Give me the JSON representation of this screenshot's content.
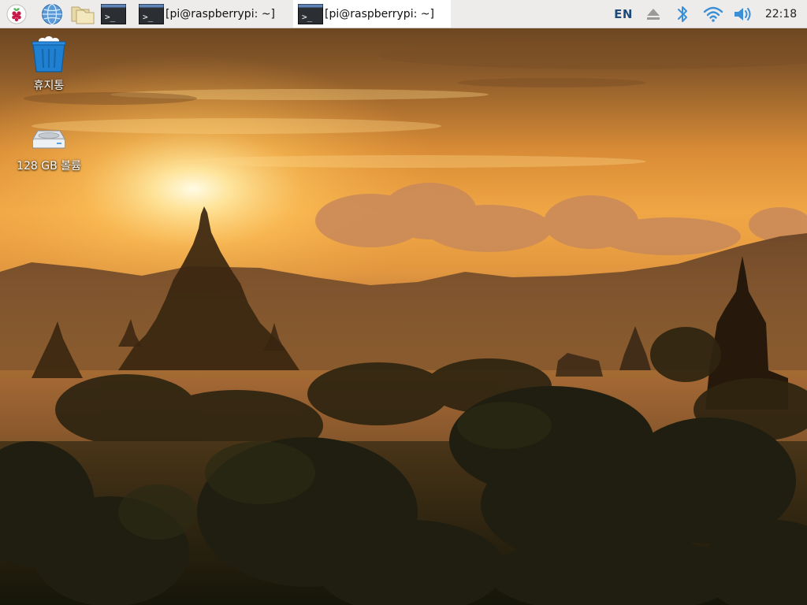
{
  "taskbar": {
    "launchers": [
      {
        "icon": "raspberry-menu-icon"
      },
      {
        "icon": "web-browser-icon"
      },
      {
        "icon": "file-manager-icon"
      },
      {
        "icon": "terminal-icon"
      }
    ],
    "windows": [
      {
        "icon": "terminal-icon",
        "title": "[pi@raspberrypi: ~]",
        "active": false
      },
      {
        "icon": "terminal-icon",
        "title": "[pi@raspberrypi: ~]",
        "active": true
      }
    ],
    "tray": {
      "language": "EN",
      "eject_icon": "eject-icon",
      "bluetooth_icon": "bluetooth-icon",
      "wifi_icon": "wifi-icon",
      "volume_icon": "volume-icon",
      "clock": "22:18"
    },
    "colors": {
      "background": "#edeceb",
      "active_window": "#ffffff",
      "tray_accent": "#3b8fd6",
      "language_text": "#1f4b7a"
    }
  },
  "desktop": {
    "icons": [
      {
        "icon": "trash-icon",
        "label": "휴지통"
      },
      {
        "icon": "drive-icon",
        "label": "128 GB 볼륨"
      }
    ],
    "wallpaper": {
      "subject": "sunset over temples with silhouetted trees",
      "colors": {
        "sky_top": "#5a3a1c",
        "sky_glow": "#f7c260",
        "sun": "#fff3c2",
        "hills": "#6a4628",
        "foreground": "#1b1a0e"
      }
    }
  }
}
